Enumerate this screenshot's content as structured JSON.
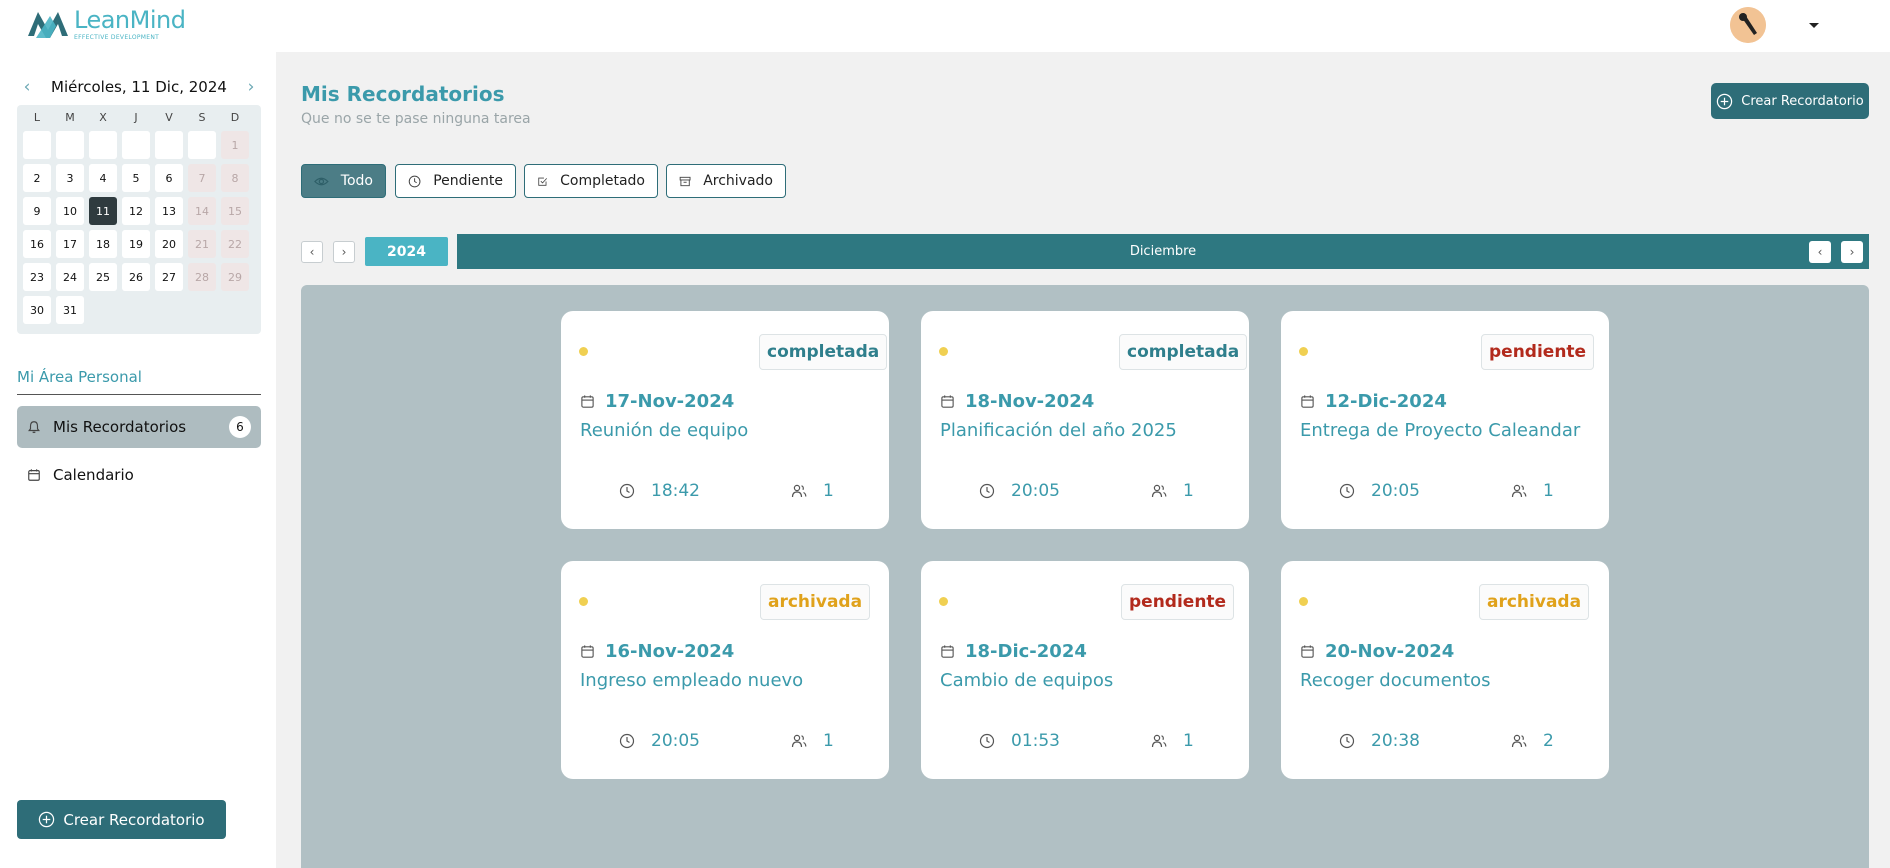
{
  "app": {
    "logo_name": "LeanMind",
    "logo_tagline": "EFFECTIVE DEVELOPMENT"
  },
  "calendar": {
    "title": "Miércoles, 11 Dic, 2024",
    "prev_icon": "chevron-left-icon",
    "next_icon": "chevron-right-icon",
    "weekdays": [
      "L",
      "M",
      "X",
      "J",
      "V",
      "S",
      "D"
    ],
    "days": [
      "1",
      "2",
      "3",
      "4",
      "5",
      "6",
      "7",
      "8",
      "9",
      "10",
      "11",
      "12",
      "13",
      "14",
      "15",
      "16",
      "17",
      "18",
      "19",
      "20",
      "21",
      "22",
      "23",
      "24",
      "25",
      "26",
      "27",
      "28",
      "29",
      "30",
      "31"
    ],
    "selected_day": "11"
  },
  "sidebar": {
    "section_title": "Mi Área Personal",
    "items": [
      {
        "label": "Mis Recordatorios",
        "badge": "6",
        "icon": "bell-icon"
      },
      {
        "label": "Calendario",
        "icon": "calendar-icon"
      }
    ],
    "create_label": "Crear Recordatorio"
  },
  "main": {
    "title": "Mis Recordatorios",
    "subtitle": "Que no se te pase ninguna tarea",
    "create_label": "Crear Recordatorio",
    "filters": [
      {
        "label": "Todo",
        "icon": "eye-icon"
      },
      {
        "label": "Pendiente",
        "icon": "clock-icon"
      },
      {
        "label": "Completado",
        "icon": "check-square-icon"
      },
      {
        "label": "Archivado",
        "icon": "archive-icon"
      }
    ],
    "year": "2024",
    "month": "Diciembre"
  },
  "reminders": [
    {
      "status": "completada",
      "date": "17-Nov-2024",
      "title": "Reunión de equipo",
      "time": "18:42",
      "people": "1"
    },
    {
      "status": "completada",
      "date": "18-Nov-2024",
      "title": "Planificación del año 2025",
      "time": "20:05",
      "people": "1"
    },
    {
      "status": "pendiente",
      "date": "12-Dic-2024",
      "title": "Entrega de Proyecto Caleandar",
      "time": "20:05",
      "people": "1"
    },
    {
      "status": "archivada",
      "date": "16-Nov-2024",
      "title": "Ingreso empleado nuevo",
      "time": "20:05",
      "people": "1"
    },
    {
      "status": "pendiente",
      "date": "18-Dic-2024",
      "title": "Cambio de equipos",
      "time": "01:53",
      "people": "1"
    },
    {
      "status": "archivada",
      "date": "20-Nov-2024",
      "title": "Recoger documentos",
      "time": "20:38",
      "people": "2"
    }
  ],
  "colors": {
    "accent": "#3b9aab",
    "primary_dark": "#2e6d78",
    "month_bar": "#2e7881",
    "year_chip": "#4ab4c4",
    "board": "#b1c0c4",
    "status_completada": "#2f7f8c",
    "status_pendiente": "#b22a1c",
    "status_archivada": "#e0a21b"
  }
}
